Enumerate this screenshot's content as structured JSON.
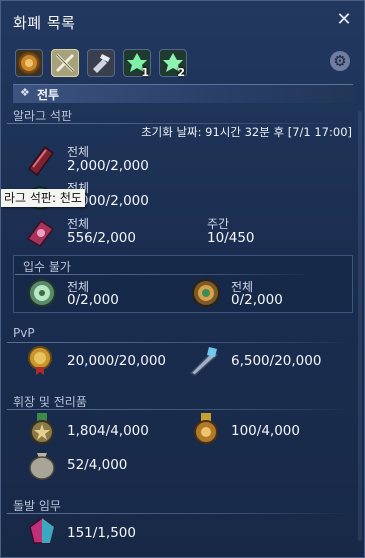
{
  "window": {
    "title": "화폐 목록",
    "close": "✕"
  },
  "tabs": [
    {
      "name": "general",
      "sub": ""
    },
    {
      "name": "combat",
      "sub": ""
    },
    {
      "name": "crafting-gathering",
      "sub": ""
    },
    {
      "name": "tribe-1",
      "sub": "1"
    },
    {
      "name": "tribe-2",
      "sub": "2"
    }
  ],
  "settings_icon": "gear-icon",
  "category": {
    "label": "전투",
    "marker": "❖"
  },
  "sections": {
    "allagan": {
      "header": "알라그 석판",
      "reset": "초기화 날짜: 91시간 32분 후 [7/1 17:00]",
      "items": [
        {
          "icon": "allagan-tomestone-red-icon",
          "label": "전체",
          "value": "2,000/2,000"
        },
        {
          "icon": "allagan-tomestone-green-icon",
          "label": "전체",
          "value": "2,000/2,000"
        },
        {
          "icon": "allagan-tomestone-pink-icon",
          "label": "전체",
          "value": "556/2,000",
          "weekly_label": "주간",
          "weekly_value": "10/450"
        }
      ],
      "unavailable": {
        "header": "입수 불가",
        "items": [
          {
            "icon": "tomestone-green-disc-icon",
            "label": "전체",
            "value": "0/2,000"
          },
          {
            "icon": "tomestone-orange-disc-icon",
            "label": "전체",
            "value": "0/2,000"
          }
        ]
      }
    },
    "pvp": {
      "header": "PvP",
      "items": [
        {
          "icon": "wolf-mark-icon",
          "value": "20,000/20,000"
        },
        {
          "icon": "trophy-crystal-icon",
          "value": "6,500/20,000"
        }
      ]
    },
    "seals": {
      "header": "휘장 및 전리품",
      "items": [
        {
          "icon": "allied-seal-icon",
          "value": "1,804/4,000"
        },
        {
          "icon": "centurio-seal-icon",
          "value": "100/4,000"
        },
        {
          "icon": "sack-of-nuts-icon",
          "value": "52/4,000"
        }
      ]
    },
    "hunts": {
      "header": "돌발 임무",
      "items": [
        {
          "icon": "bicolor-gemstone-icon",
          "value": "151/1,500"
        }
      ]
    }
  },
  "tooltip": "라그 석판: 천도",
  "colors": {
    "panel": "#1b2e51",
    "accent": "#3d5481",
    "text": "#f4f6fa"
  }
}
